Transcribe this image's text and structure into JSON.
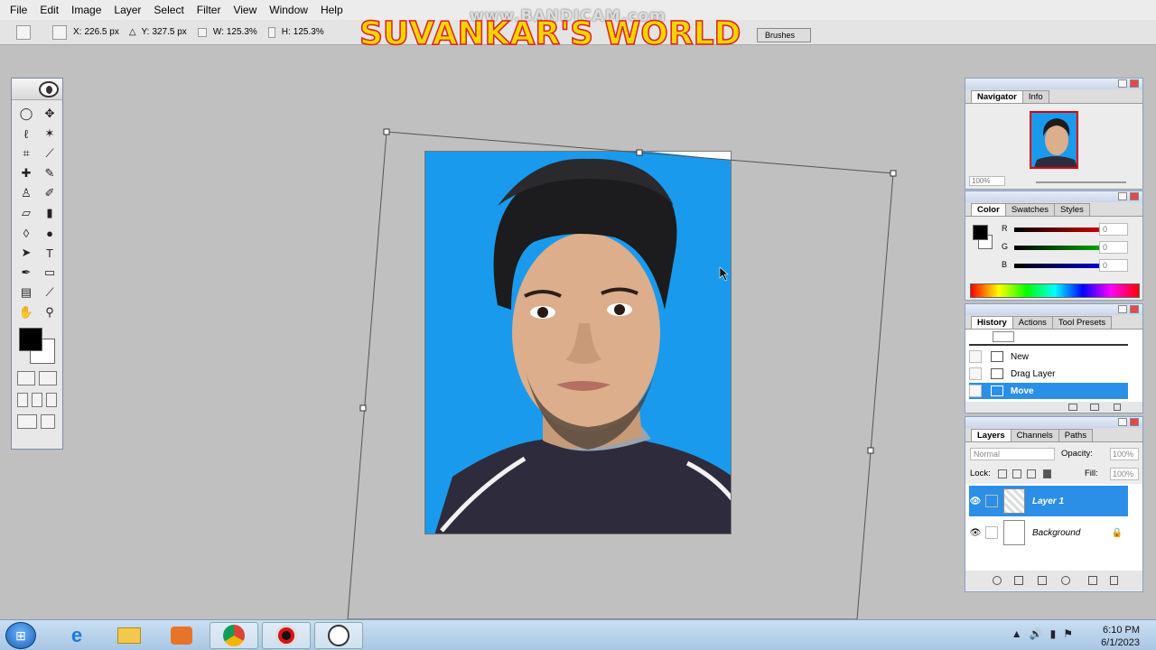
{
  "menubar": {
    "items": [
      "File",
      "Edit",
      "Image",
      "Layer",
      "Select",
      "Filter",
      "View",
      "Window",
      "Help"
    ]
  },
  "options": {
    "x_label": "X:",
    "x_value": "226.5 px",
    "y_label": "Y:",
    "y_value": "327.5 px",
    "w_label": "W:",
    "w_value": "125.3%",
    "h_label": "H:",
    "h_value": "125.3%",
    "brushes_tab": "Brushes"
  },
  "overlay": {
    "watermark": "www.BANDICAM.com",
    "channel_title": "SUVANKAR'S WORLD"
  },
  "toolbox": {
    "foreground_color": "#000000",
    "background_color": "#ffffff"
  },
  "navigator": {
    "tabs": [
      "Navigator",
      "Info"
    ],
    "zoom": "100%"
  },
  "color_panel": {
    "tabs": [
      "Color",
      "Swatches",
      "Styles"
    ],
    "r_label": "R",
    "r_value": "0",
    "g_label": "G",
    "g_value": "0",
    "b_label": "B",
    "b_value": "0"
  },
  "history": {
    "tabs": [
      "History",
      "Actions",
      "Tool Presets"
    ],
    "items": [
      "New",
      "Drag Layer",
      "Move"
    ],
    "active_index": 2
  },
  "layers": {
    "tabs": [
      "Layers",
      "Channels",
      "Paths"
    ],
    "blend_mode": "Normal",
    "opacity_label": "Opacity:",
    "opacity_value": "100%",
    "lock_label": "Lock:",
    "fill_label": "Fill:",
    "fill_value": "100%",
    "items": [
      "Layer 1",
      "Background"
    ],
    "active_index": 0
  },
  "taskbar": {
    "time": "6:10 PM",
    "date": "6/1/2023"
  },
  "colors": {
    "photo_background": "#1a9aed",
    "selection": "#2b8fe8"
  }
}
